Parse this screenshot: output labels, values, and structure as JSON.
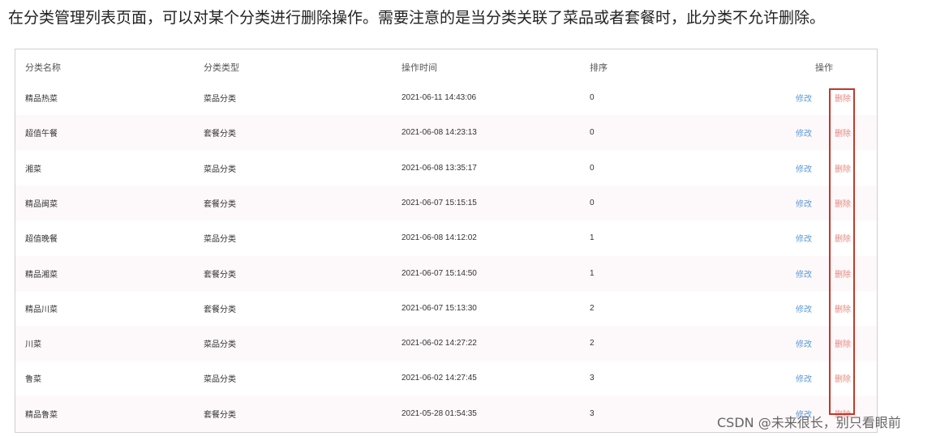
{
  "intro": {
    "text": "在分类管理列表页面，可以对某个分类进行删除操作。需要注意的是当分类关联了菜品或者套餐时，此分类不允许删除。"
  },
  "table": {
    "headers": {
      "name": "分类名称",
      "type": "分类类型",
      "time": "操作时间",
      "sort": "排序",
      "ops": "操作"
    },
    "rows": [
      {
        "name": "精品热菜",
        "type": "菜品分类",
        "time": "2021-06-11 14:43:06",
        "sort": "0",
        "edit": "修改",
        "delete": "删除"
      },
      {
        "name": "超值午餐",
        "type": "套餐分类",
        "time": "2021-06-08 14:23:13",
        "sort": "0",
        "edit": "修改",
        "delete": "删除"
      },
      {
        "name": "湘菜",
        "type": "菜品分类",
        "time": "2021-06-08 13:35:17",
        "sort": "0",
        "edit": "修改",
        "delete": "删除"
      },
      {
        "name": "精品闽菜",
        "type": "套餐分类",
        "time": "2021-06-07 15:15:15",
        "sort": "0",
        "edit": "修改",
        "delete": "删除"
      },
      {
        "name": "超值晚餐",
        "type": "菜品分类",
        "time": "2021-06-08 14:12:02",
        "sort": "1",
        "edit": "修改",
        "delete": "删除"
      },
      {
        "name": "精品湘菜",
        "type": "套餐分类",
        "time": "2021-06-07 15:14:50",
        "sort": "1",
        "edit": "修改",
        "delete": "删除"
      },
      {
        "name": "精品川菜",
        "type": "套餐分类",
        "time": "2021-06-07 15:13:30",
        "sort": "2",
        "edit": "修改",
        "delete": "删除"
      },
      {
        "name": "川菜",
        "type": "菜品分类",
        "time": "2021-06-02 14:27:22",
        "sort": "2",
        "edit": "修改",
        "delete": "删除"
      },
      {
        "name": "鲁菜",
        "type": "菜品分类",
        "time": "2021-06-02 14:27:45",
        "sort": "3",
        "edit": "修改",
        "delete": "删除"
      },
      {
        "name": "精品鲁菜",
        "type": "套餐分类",
        "time": "2021-05-28 01:54:35",
        "sort": "3",
        "edit": "修改",
        "delete": "删除"
      }
    ]
  },
  "watermark": {
    "text": "CSDN @未来很长，别只看眼前"
  },
  "colors": {
    "edit_link": "#5b9bd5",
    "delete_link": "#e58a80",
    "highlight_box": "#c0392b",
    "alt_row": "#fdf8fa"
  }
}
